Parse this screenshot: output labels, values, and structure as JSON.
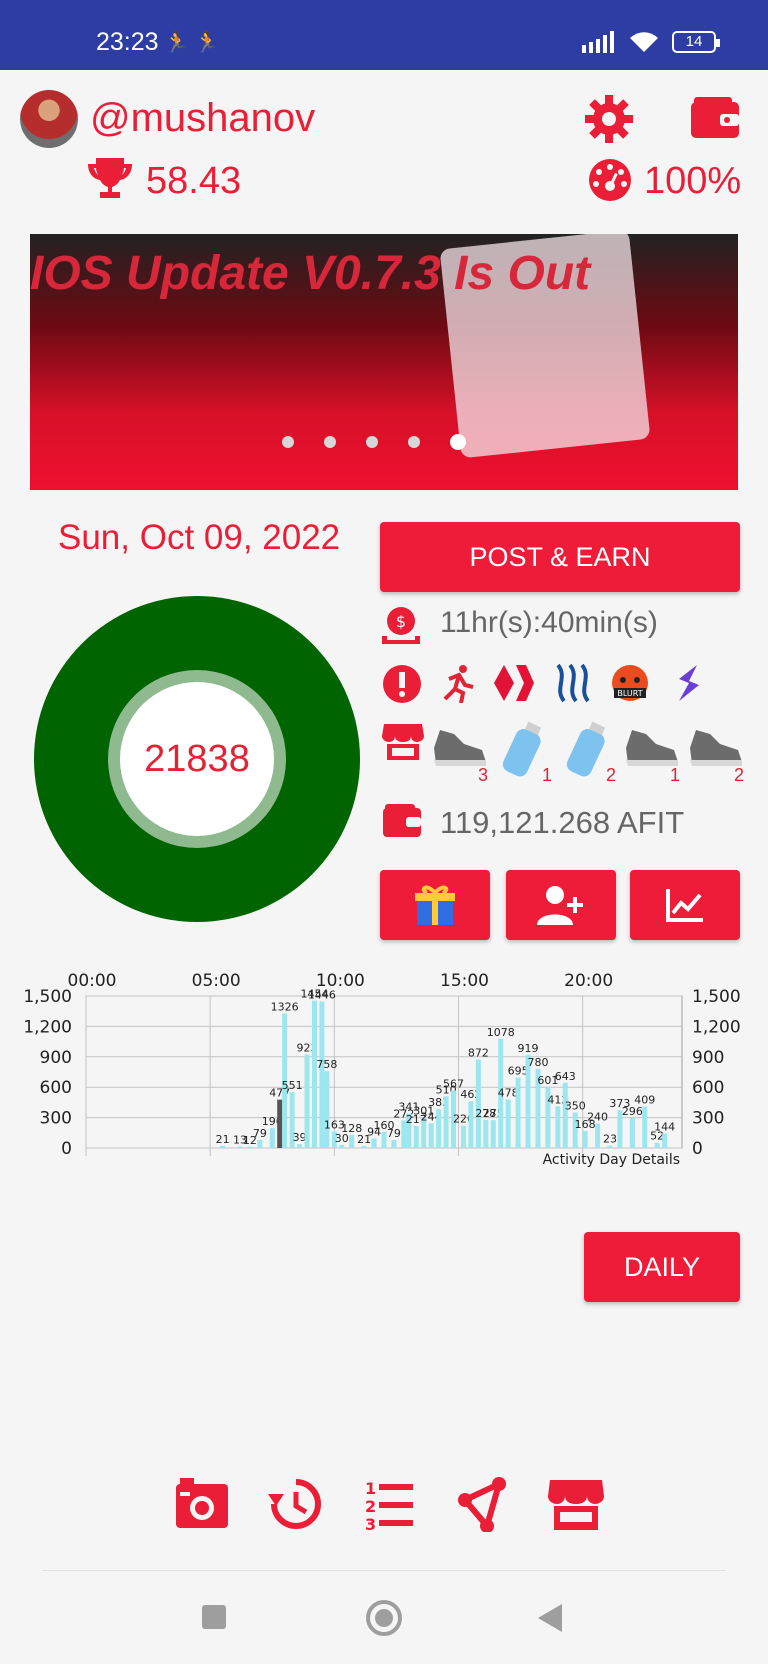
{
  "status_bar": {
    "time": "23:23",
    "activity": "🏃 🏃",
    "battery": "14"
  },
  "profile": {
    "username": "@mushanov",
    "score": "58.43",
    "performance": "100%"
  },
  "banner": {
    "title": "IOS Update V0.7.3 Is Out",
    "slide_count": 5,
    "active_slide": 5
  },
  "date": "Sun, Oct 09, 2022",
  "steps": "21838",
  "actions": {
    "post_earn": "POST & EARN",
    "time_left": "11hr(s):40min(s)",
    "daily": "DAILY"
  },
  "chips": [
    "running-icon",
    "hive-icon",
    "steem-icon",
    "blurt-icon",
    "splinterlands-icon"
  ],
  "blurt_label": "BLURT",
  "inventory": [
    {
      "name": "shoe-icon",
      "count": "3"
    },
    {
      "name": "water-bottle-icon",
      "count": "1"
    },
    {
      "name": "water-bottle-icon",
      "count": "2"
    },
    {
      "name": "shoe-icon",
      "count": "1"
    },
    {
      "name": "shoe-icon",
      "count": "2"
    }
  ],
  "balance": "119,121.268 AFIT",
  "colors": {
    "accent": "#ee1c39",
    "status_bar": "#2d3da4",
    "donut": "#006400",
    "bars": "#9ce6ef"
  },
  "chart_data": {
    "type": "bar",
    "title": "Activity Day Details",
    "x_ticks": [
      "00:00",
      "05:00",
      "10:00",
      "15:00",
      "20:00"
    ],
    "y_ticks": [
      "0",
      "300",
      "600",
      "900",
      "1,200",
      "1,500"
    ],
    "ylim": [
      0,
      1500
    ],
    "xlim": [
      0,
      24
    ],
    "x": [
      5.5,
      6.2,
      6.6,
      7.0,
      7.5,
      7.8,
      8.0,
      8.3,
      8.6,
      8.9,
      9.2,
      9.5,
      9.7,
      10.0,
      10.3,
      10.7,
      11.2,
      11.6,
      12.0,
      12.4,
      12.8,
      13.0,
      13.3,
      13.6,
      13.9,
      14.2,
      14.5,
      14.8,
      15.2,
      15.5,
      15.8,
      16.1,
      16.4,
      16.7,
      17.0,
      17.4,
      17.8,
      18.2,
      18.6,
      19.0,
      19.3,
      19.7,
      20.1,
      20.6,
      21.1,
      21.5,
      22.0,
      22.5,
      23.0,
      23.3
    ],
    "values": [
      21,
      13,
      12,
      79,
      196,
      477,
      1326,
      551,
      39,
      923,
      1454,
      1446,
      758,
      163,
      30,
      128,
      21,
      94,
      160,
      79,
      272,
      341,
      217,
      301,
      244,
      383,
      510,
      567,
      220,
      462,
      872,
      278,
      275,
      1078,
      478,
      695,
      919,
      780,
      601,
      412,
      643,
      350,
      168,
      240,
      23,
      373,
      296,
      409,
      52,
      144
    ],
    "highlight_index": 5
  },
  "bottom_nav": [
    "camera-icon",
    "history-icon",
    "leaderboard-icon",
    "share-icon",
    "market-icon"
  ]
}
